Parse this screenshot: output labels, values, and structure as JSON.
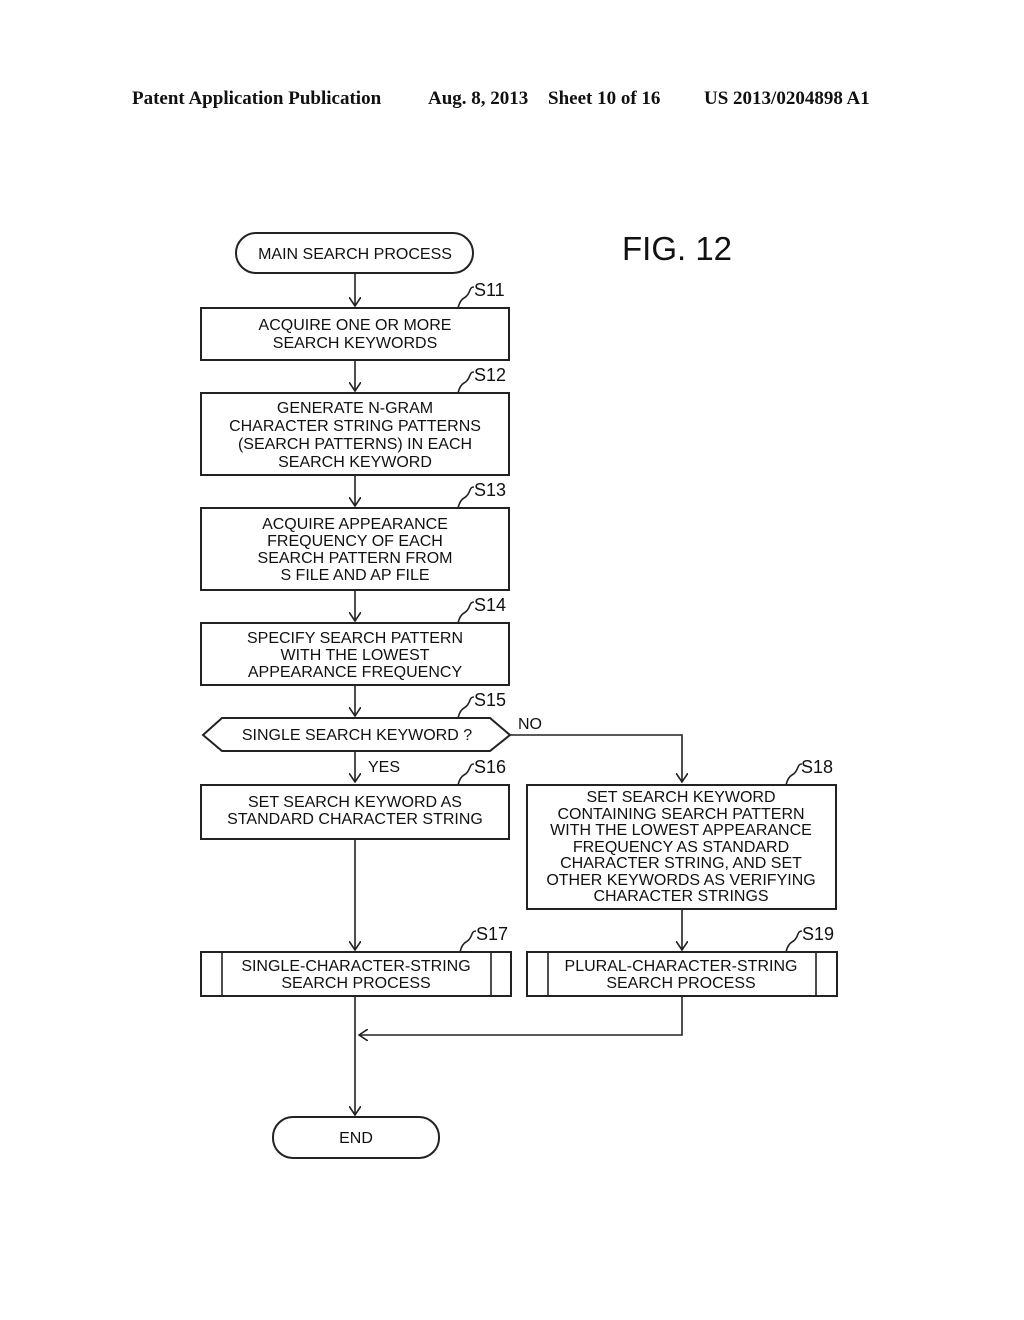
{
  "header": {
    "publication": "Patent Application Publication",
    "date": "Aug. 8, 2013",
    "sheet": "Sheet 10 of 16",
    "number": "US 2013/0204898 A1"
  },
  "figure": {
    "title": "FIG. 12"
  },
  "flowchart": {
    "start": {
      "text": "MAIN SEARCH PROCESS"
    },
    "steps": {
      "S11": {
        "label": "S11",
        "lines": [
          "ACQUIRE ONE OR MORE",
          "SEARCH KEYWORDS"
        ]
      },
      "S12": {
        "label": "S12",
        "lines": [
          "GENERATE N-GRAM",
          "CHARACTER STRING PATTERNS",
          "(SEARCH PATTERNS) IN EACH",
          "SEARCH KEYWORD"
        ]
      },
      "S13": {
        "label": "S13",
        "lines": [
          "ACQUIRE APPEARANCE",
          "FREQUENCY OF EACH",
          "SEARCH PATTERN FROM",
          "S FILE AND AP FILE"
        ]
      },
      "S14": {
        "label": "S14",
        "lines": [
          "SPECIFY SEARCH PATTERN",
          "WITH THE LOWEST",
          "APPEARANCE FREQUENCY"
        ]
      },
      "S15": {
        "label": "S15",
        "lines": [
          "SINGLE SEARCH KEYWORD ?"
        ],
        "yes": "YES",
        "no": "NO"
      },
      "S16": {
        "label": "S16",
        "lines": [
          "SET SEARCH KEYWORD AS",
          "STANDARD CHARACTER STRING"
        ]
      },
      "S17": {
        "label": "S17",
        "lines": [
          "SINGLE-CHARACTER-STRING",
          "SEARCH PROCESS"
        ]
      },
      "S18": {
        "label": "S18",
        "lines": [
          "SET SEARCH KEYWORD",
          "CONTAINING SEARCH PATTERN",
          "WITH THE LOWEST APPEARANCE",
          "FREQUENCY AS STANDARD",
          "CHARACTER STRING, AND SET",
          "OTHER KEYWORDS AS VERIFYING",
          "CHARACTER STRINGS"
        ]
      },
      "S19": {
        "label": "S19",
        "lines": [
          "PLURAL-CHARACTER-STRING",
          "SEARCH PROCESS"
        ]
      }
    },
    "end": {
      "text": "END"
    }
  }
}
